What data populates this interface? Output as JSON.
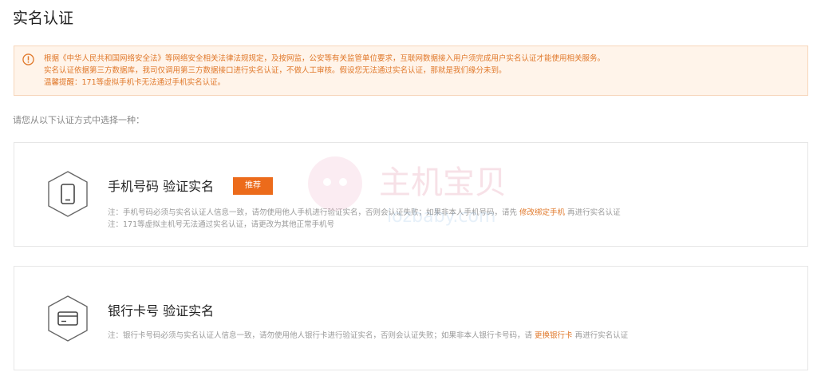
{
  "page": {
    "title": "实名认证"
  },
  "notice": {
    "lines": [
      "根据《中华人民共和国网络安全法》等网络安全相关法律法规规定，及按网监，公安等有关监管单位要求，互联网数据接入用户须完成用户实名认证才能使用相关服务。",
      "实名认证依据第三方数据库，我司仅调用第三方数据接口进行实名认证，不做人工审核。假设您无法通过实名认证，那就是我们缘分未到。",
      "温馨提醒：171等虚拟手机卡无法通过手机实名认证。"
    ]
  },
  "choose_label": "请您从以下认证方式中选择一种：",
  "phone_card": {
    "title": "手机号码 验证实名",
    "badge": "推荐",
    "note1_before": "注：手机号码必须与实名认证人信息一致，请勿使用他人手机进行验证实名，否则会认证失败；如果非本人手机号码，请先 ",
    "note1_link": "修改绑定手机",
    "note1_after": " 再进行实名认证",
    "note2": "注：171等虚拟主机号无法通过实名认证，请更改为其他正常手机号"
  },
  "bank_card": {
    "title": "银行卡号 验证实名",
    "note_before": "注：银行卡号码必须与实名认证人信息一致，请勿使用他人银行卡进行验证实名，否则会认证失败；如果非本人银行卡号码，请 ",
    "note_link": "更换银行卡",
    "note_after": " 再进行实名认证"
  },
  "watermark": {
    "cn": "主机宝贝",
    "en": "iozbaby.com"
  },
  "colors": {
    "accent": "#ec6b1b",
    "notice_bg": "#fff4ea",
    "notice_text": "#e0782a"
  },
  "icons": {
    "notice": "warning-circle-icon",
    "phone": "phone-hexagon-icon",
    "bank": "bank-card-hexagon-icon"
  }
}
